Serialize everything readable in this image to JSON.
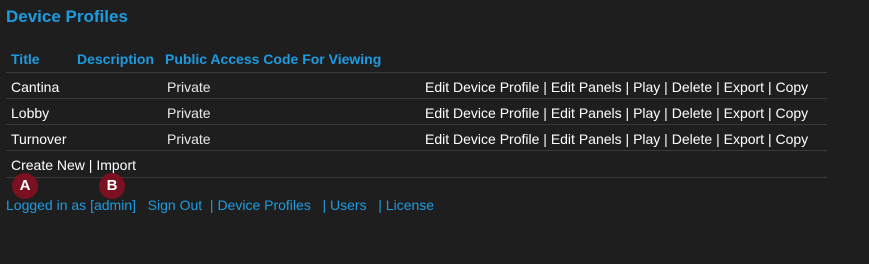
{
  "page": {
    "title": "Device Profiles"
  },
  "table": {
    "headers": {
      "title": "Title",
      "description": "Description",
      "access": "Public Access Code For Viewing"
    },
    "rows": [
      {
        "title": "Cantina",
        "description": "",
        "access": "Private"
      },
      {
        "title": "Lobby",
        "description": "",
        "access": "Private"
      },
      {
        "title": "Turnover",
        "description": "",
        "access": "Private"
      }
    ],
    "actions": {
      "edit_profile": "Edit Device Profile",
      "edit_panels": "Edit Panels",
      "play": "Play",
      "delete": "Delete",
      "export": "Export",
      "copy": "Copy",
      "separator": " | "
    }
  },
  "bottom_actions": {
    "create_new": "Create New",
    "import": "Import",
    "separator": " | "
  },
  "markers": {
    "a": "A",
    "b": "B"
  },
  "footer": {
    "logged_in": "Logged in as [admin]",
    "sign_out": "Sign Out",
    "device_profiles": "Device Profiles",
    "users": "Users",
    "license": "License",
    "separator": "|"
  },
  "colors": {
    "accent": "#1e9be0",
    "background": "#1e1e1e",
    "marker": "#7a1020"
  }
}
